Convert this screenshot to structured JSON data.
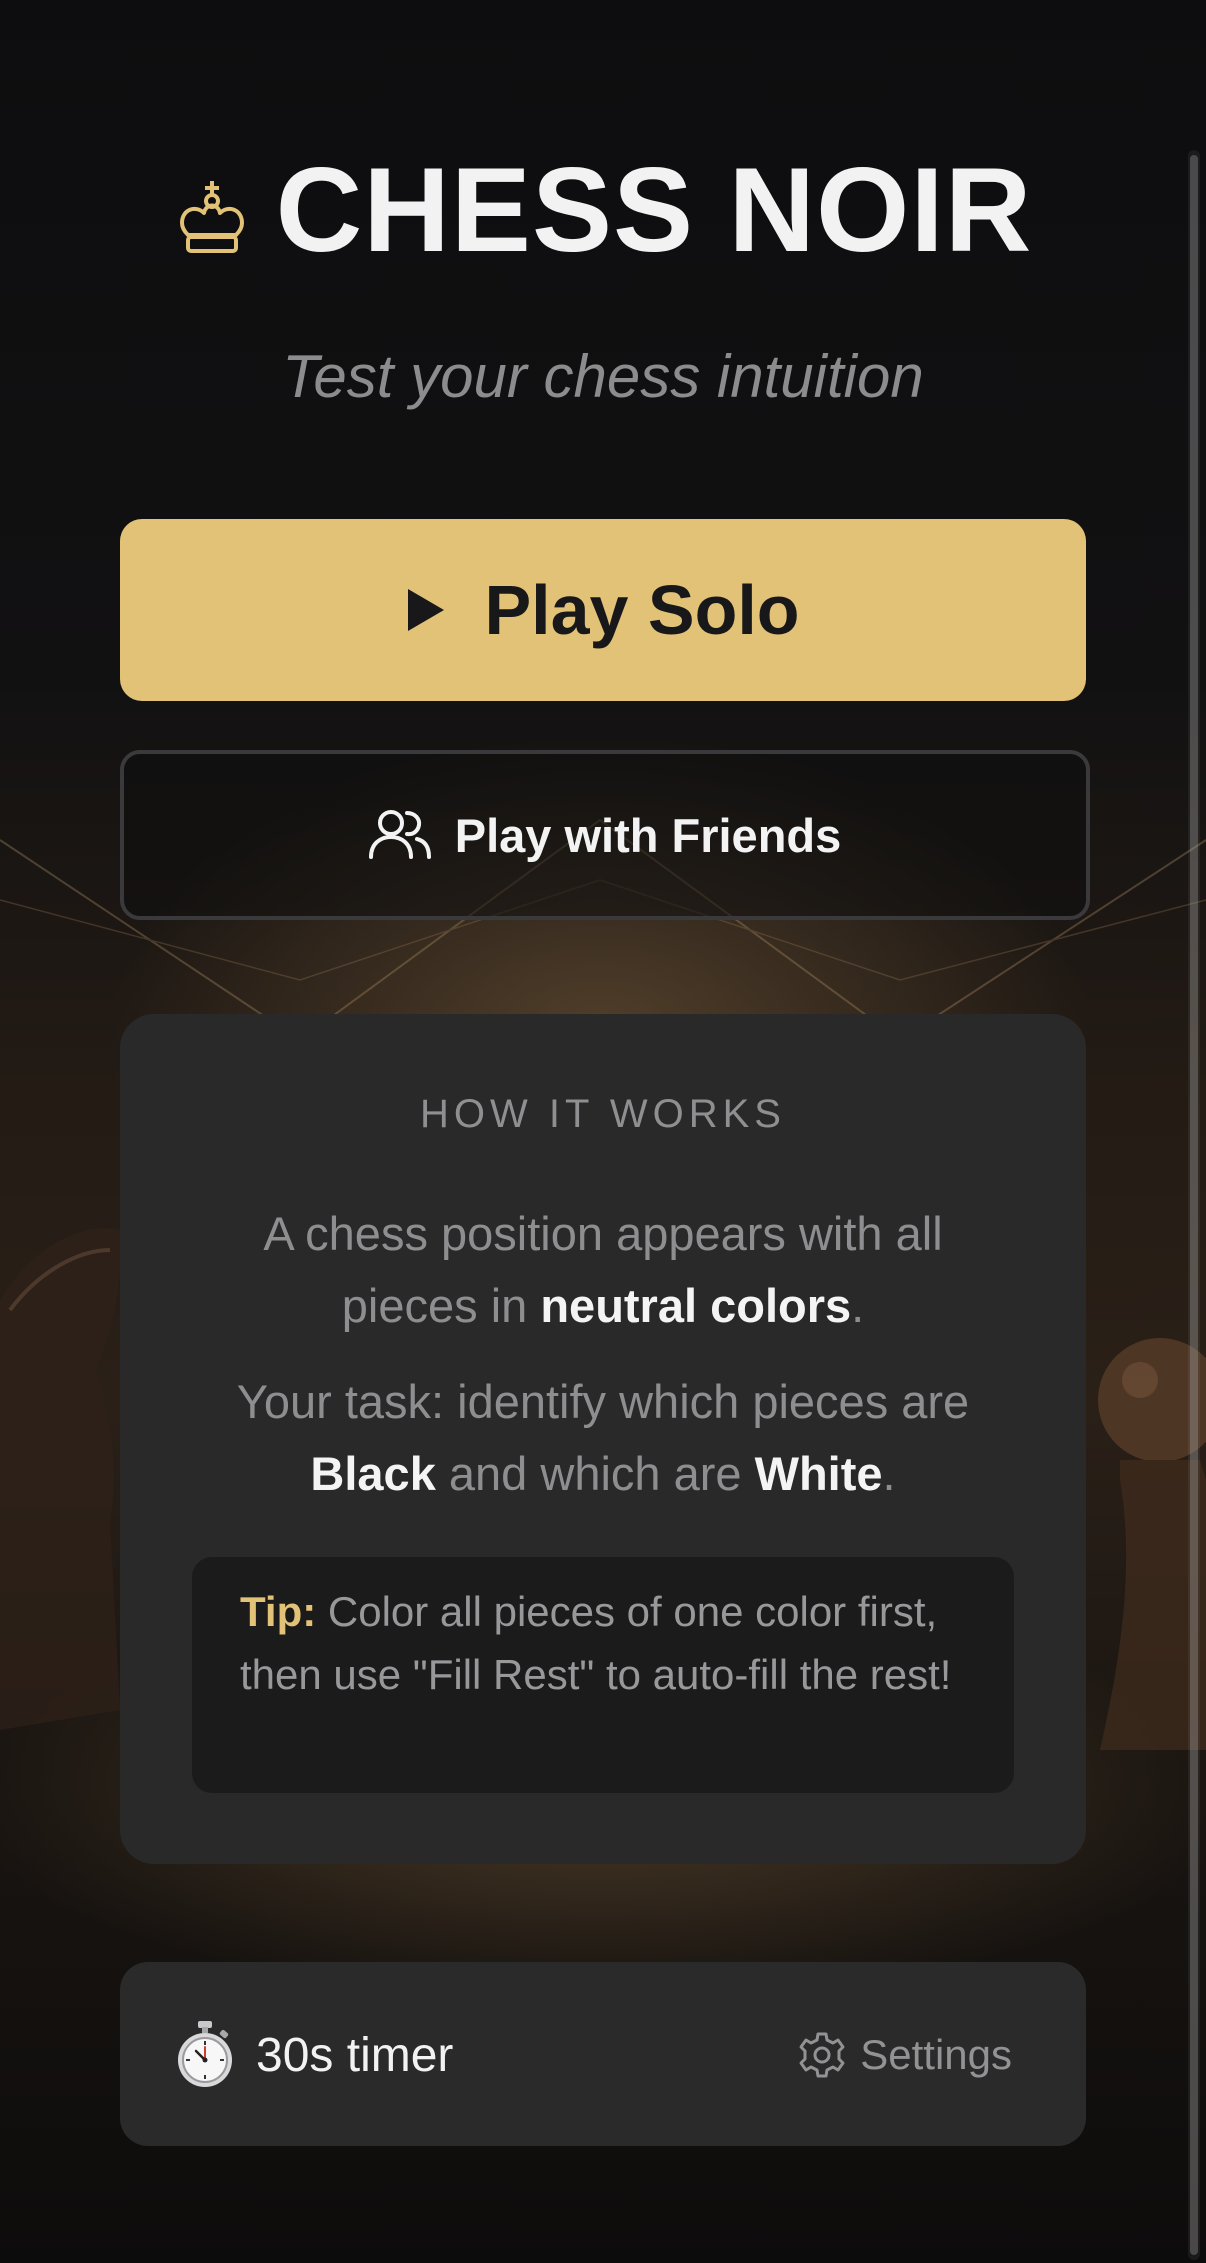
{
  "app": {
    "title": "CHESS NOIR",
    "subtitle": "Test your chess intuition"
  },
  "actions": {
    "play_solo_label": "Play Solo",
    "play_friends_label": "Play with Friends"
  },
  "how_it_works": {
    "heading": "HOW IT WORKS",
    "p1_before": "A chess position appears with all pieces in ",
    "p1_bold": "neutral colors",
    "p1_after": ".",
    "p2_before": "Your task: identify which pieces are ",
    "p2_bold1": "Black",
    "p2_middle": " and which are ",
    "p2_bold2": "White",
    "p2_after": ".",
    "tip_label": "Tip:",
    "tip_text": " Color all pieces of one color first, then use \"Fill Rest\" to auto-fill the rest!"
  },
  "footer": {
    "timer_label": "30s timer",
    "settings_label": "Settings"
  },
  "icons": {
    "title": "crown-icon",
    "play_solo": "play-triangle-icon",
    "play_friends": "users-icon",
    "timer": "stopwatch-icon",
    "settings": "gear-icon"
  },
  "colors": {
    "accent_gold": "#e1c276",
    "card_bg": "#29292a",
    "tip_bg": "#1b1b1c",
    "text_primary": "#f2f2f3",
    "text_muted": "#8e8e90"
  }
}
